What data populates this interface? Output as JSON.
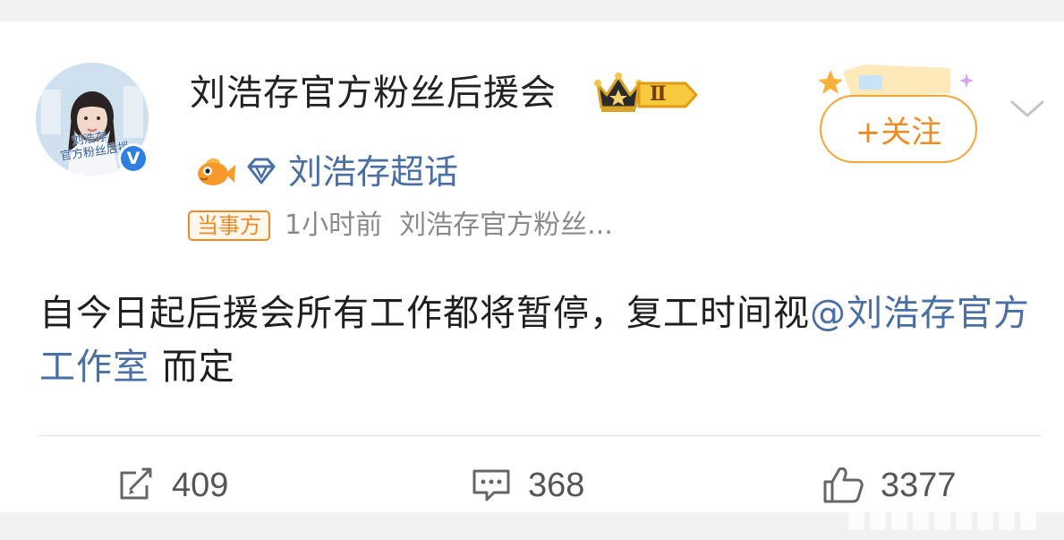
{
  "post": {
    "author_name": "刘浩存官方粉丝后援会",
    "avatar_caption": "刘浩存\n官方粉丝后援",
    "verified_badge": "V",
    "level_badge": "Ⅱ",
    "super_topic": "刘浩存超话",
    "party_tag": "当事方",
    "meta": "1小时前  刘浩存官方粉丝...",
    "follow_label": "+关注",
    "content_text": "自今日起后援会所有工作都将暂停，复工时间视",
    "mention": "@刘浩存官方工作室",
    "content_tail": " 而定"
  },
  "actions": {
    "repost_count": "409",
    "comment_count": "368",
    "like_count": "3377"
  },
  "colors": {
    "accent_orange": "#f08a24",
    "link_blue": "#4a6fa5",
    "verified_blue": "#2e7fe0"
  },
  "icons": [
    "crown-icon",
    "level-badge-icon",
    "fish-icon",
    "diamond-icon",
    "chevron-down-icon",
    "repost-icon",
    "comment-icon",
    "like-icon"
  ]
}
